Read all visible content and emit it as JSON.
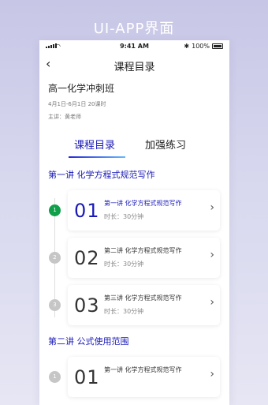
{
  "banner": {
    "title": "UI-APP界面"
  },
  "status_bar": {
    "time": "9:41 AM",
    "battery": "100%",
    "bluetooth_glyph": "✱"
  },
  "nav": {
    "back_glyph": "‹",
    "title": "课程目录"
  },
  "course": {
    "name": "高一化学冲刺班",
    "meta": "4月1日-6月1日  20课时",
    "teacher_label": "主讲：",
    "teacher": "黄老师"
  },
  "tabs": [
    {
      "label": "课程目录",
      "active": true
    },
    {
      "label": "加强练习",
      "active": false
    }
  ],
  "sections": [
    {
      "title": "第一讲   化学方程式规范写作",
      "lessons": [
        {
          "index": "1",
          "number": "01",
          "title": "第一讲   化学方程式规范写作",
          "duration": "时长：30分钟",
          "active": true
        },
        {
          "index": "2",
          "number": "02",
          "title": "第二讲   化学方程式规范写作",
          "duration": "时长：30分钟",
          "active": false
        },
        {
          "index": "3",
          "number": "03",
          "title": "第三讲   化学方程式规范写作",
          "duration": "时长：30分钟",
          "active": false
        }
      ]
    },
    {
      "title": "第二讲   公式使用范围",
      "lessons": [
        {
          "index": "1",
          "number": "01",
          "title": "第一讲   化学方程式规范写作",
          "duration": "",
          "active": false
        }
      ]
    }
  ],
  "colors": {
    "accent": "#1a1ab8",
    "active_dot": "#10a04a",
    "inactive_dot": "#c6c6c6"
  }
}
